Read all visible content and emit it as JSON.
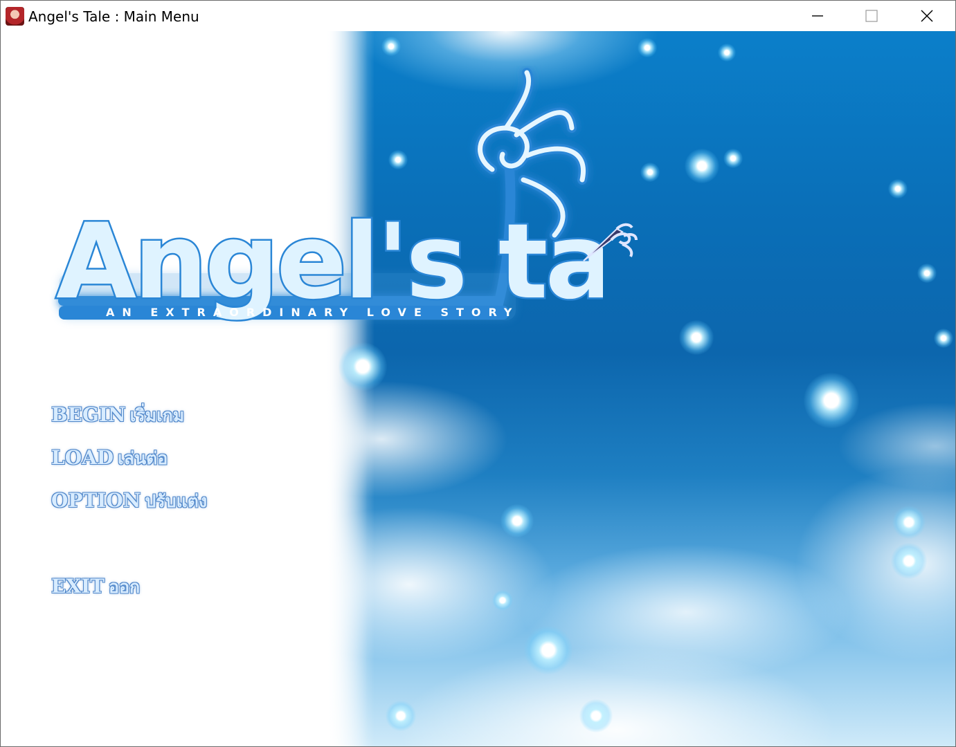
{
  "window": {
    "title": "Angel's Tale : Main Menu",
    "controls": [
      "minimize",
      "maximize",
      "close"
    ]
  },
  "logo": {
    "title": "Angel's tale",
    "subtitle": "AN EXTRAORDINARY LOVE STORY"
  },
  "menu": {
    "begin": {
      "en": "BEGIN",
      "th": "เริ่มเกม"
    },
    "load": {
      "en": "LOAD",
      "th": "เล่นต่อ"
    },
    "option": {
      "en": "OPTION",
      "th": "ปรับแต่ง"
    },
    "exit": {
      "en": "EXIT",
      "th": "ออก"
    }
  },
  "colors": {
    "sky_top": "#0b7fca",
    "sky_mid": "#0c66ad",
    "menu_text": "#d8ecff",
    "menu_outline": "#4f86c9",
    "logo_stroke": "#2a86d6"
  },
  "icons": {
    "app": "angel-portrait-icon",
    "cursor": "wing-cursor-icon"
  }
}
